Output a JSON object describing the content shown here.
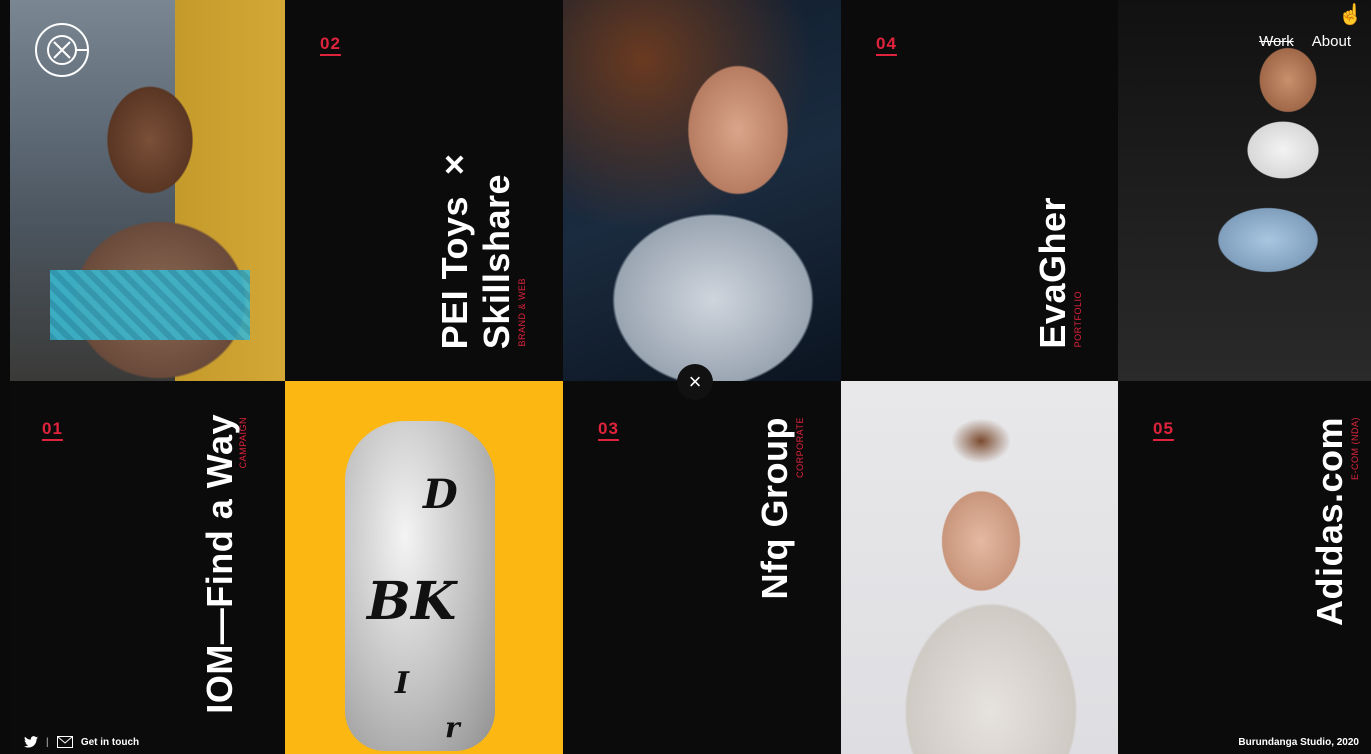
{
  "nav": {
    "work": "Work",
    "about": "About"
  },
  "projects": [
    {
      "number": "01",
      "title": "IOM—Find a Way",
      "category": "CAMPAIGN"
    },
    {
      "number": "02",
      "title": "PEI Toys ×",
      "title2": "Skillshare",
      "category": "BRAND & WEB"
    },
    {
      "number": "03",
      "title": "Nfq Group",
      "category": "CORPORATE"
    },
    {
      "number": "04",
      "title": "EvaGher",
      "category": "PORTFOLIO"
    },
    {
      "number": "05",
      "title": "Adidas.com",
      "category": "E-COM (NDA)"
    }
  ],
  "toy": {
    "m1": "D",
    "m2": "BK",
    "m3": "I",
    "m4": "r"
  },
  "footer": {
    "contact": "Get in touch",
    "copyright": "Burundanga Studio, 2020"
  },
  "icons": {
    "close": "×",
    "twitter": "twitter-icon",
    "mail": "mail-icon"
  },
  "colors": {
    "accent": "#e0233d",
    "yellow": "#fdb713",
    "background": "#0a0a0a"
  }
}
